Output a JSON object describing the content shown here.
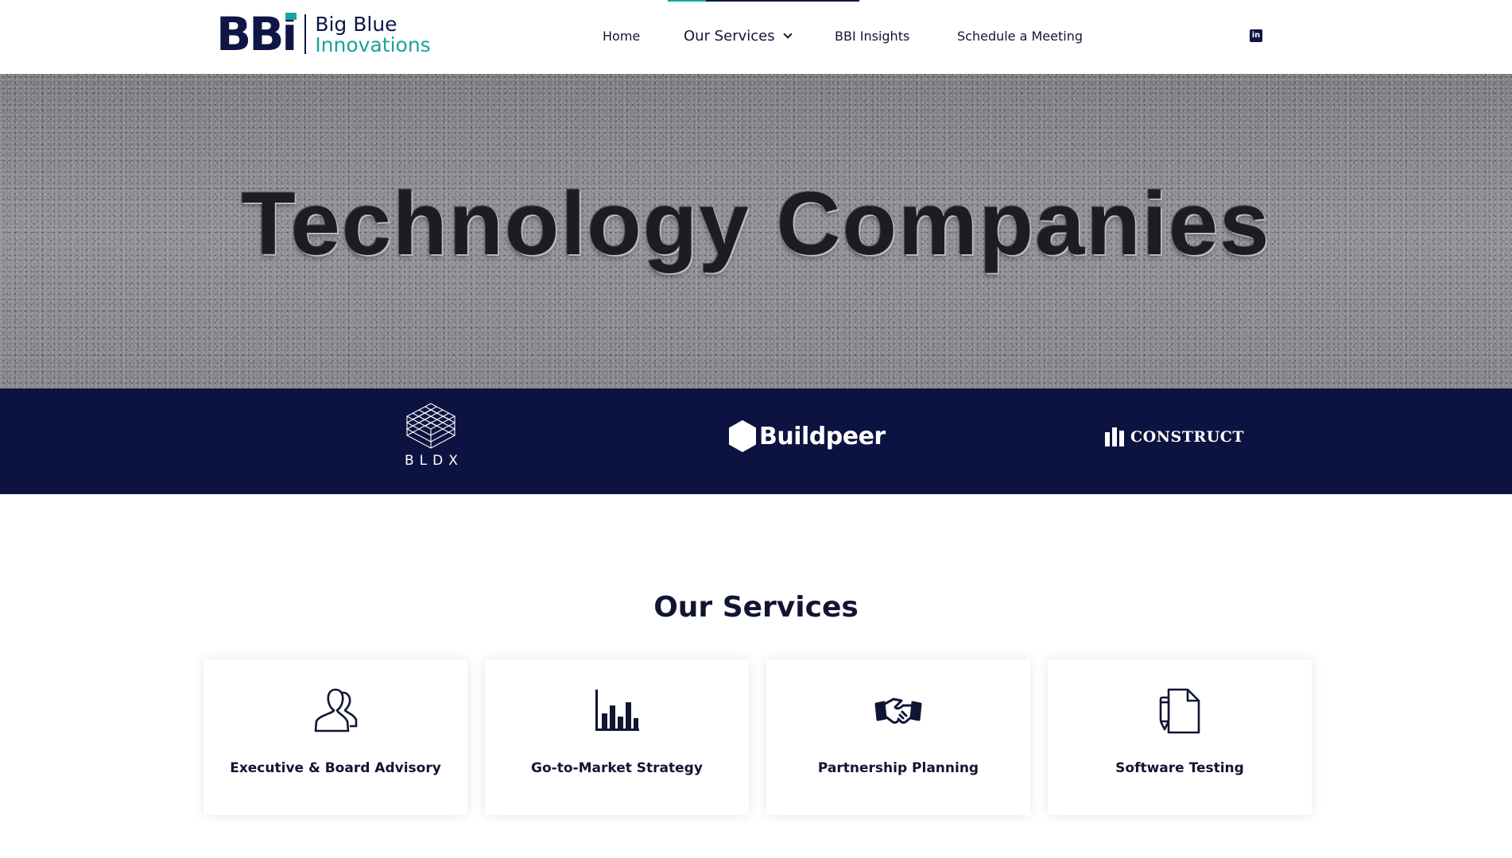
{
  "brand": {
    "mark": "BB",
    "mark_i": "i",
    "line1": "Big Blue",
    "line2": "Innovations",
    "colors": {
      "navy": "#0f1645",
      "teal": "#1aa39a"
    }
  },
  "nav": {
    "items": [
      {
        "label": "Home"
      },
      {
        "label": "Our Services",
        "has_dropdown": true,
        "active": true
      },
      {
        "label": "BBI Insights"
      },
      {
        "label": "Schedule a Meeting"
      }
    ],
    "social_icon": "linkedin-icon",
    "social_glyph": "in"
  },
  "hero": {
    "title": "Technology Companies"
  },
  "partners": {
    "background": "#0d1340",
    "logos": [
      {
        "name": "BLDX",
        "icon": "bldx-cube-icon"
      },
      {
        "name": "Buildpeer",
        "icon": "hexagon-icon"
      },
      {
        "name": "CONSTRUCT",
        "icon": "bars-icon"
      }
    ]
  },
  "services": {
    "title": "Our Services",
    "cards": [
      {
        "label": "Executive & Board Advisory",
        "icon": "people-icon"
      },
      {
        "label": "Go-to-Market Strategy",
        "icon": "bar-chart-icon"
      },
      {
        "label": "Partnership Planning",
        "icon": "handshake-icon"
      },
      {
        "label": "Software Testing",
        "icon": "document-pen-icon"
      }
    ]
  }
}
